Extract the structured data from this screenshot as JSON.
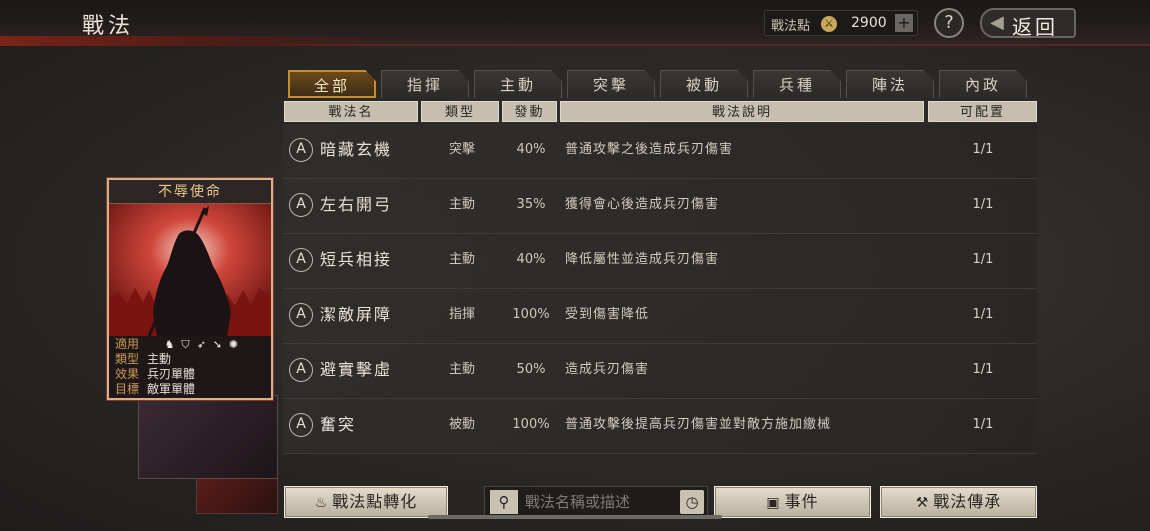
{
  "header": {
    "title": "戰法",
    "points_label": "戰法點",
    "points_value": "2900",
    "help_label": "?",
    "back_label": "返回"
  },
  "tabs": [
    {
      "label": "全部",
      "active": true
    },
    {
      "label": "指揮",
      "active": false
    },
    {
      "label": "主動",
      "active": false
    },
    {
      "label": "突擊",
      "active": false
    },
    {
      "label": "被動",
      "active": false
    },
    {
      "label": "兵種",
      "active": false
    },
    {
      "label": "陣法",
      "active": false
    },
    {
      "label": "內政",
      "active": false
    }
  ],
  "table": {
    "headers": {
      "name": "戰法名",
      "type": "類型",
      "rate": "發動",
      "desc": "戰法說明",
      "config": "可配置"
    },
    "rows": [
      {
        "grade": "A",
        "name": "暗藏玄機",
        "type": "突擊",
        "rate": "40%",
        "desc": "普通攻擊之後造成兵刃傷害",
        "config": "1/1"
      },
      {
        "grade": "A",
        "name": "左右開弓",
        "type": "主動",
        "rate": "35%",
        "desc": "獲得會心後造成兵刃傷害",
        "config": "1/1"
      },
      {
        "grade": "A",
        "name": "短兵相接",
        "type": "主動",
        "rate": "40%",
        "desc": "降低屬性並造成兵刃傷害",
        "config": "1/1"
      },
      {
        "grade": "A",
        "name": "潔敵屏障",
        "type": "指揮",
        "rate": "100%",
        "desc": "受到傷害降低",
        "config": "1/1"
      },
      {
        "grade": "A",
        "name": "避實擊虛",
        "type": "主動",
        "rate": "50%",
        "desc": "造成兵刃傷害",
        "config": "1/1"
      },
      {
        "grade": "A",
        "name": "奮突",
        "type": "被動",
        "rate": "100%",
        "desc": "普通攻擊後提高兵刃傷害並對敵方施加繳械",
        "config": "1/1"
      }
    ]
  },
  "card": {
    "title": "不辱使命",
    "applies_label": "適用",
    "unit_icons": [
      "cavalry-icon",
      "shield-icon",
      "bow-icon",
      "spear-icon",
      "siege-icon"
    ],
    "type_label": "類型",
    "type_value": "主動",
    "effect_label": "效果",
    "effect_value": "兵刃單體",
    "target_label": "目標",
    "target_value": "敵軍單體"
  },
  "bottom": {
    "convert_label": "戰法點轉化",
    "search_placeholder": "戰法名稱或描述",
    "events_label": "事件",
    "inherit_label": "戰法傳承"
  },
  "colors": {
    "accent_gold": "#c68d2e",
    "card_red": "#b02a22",
    "header_red": "#7a2418"
  }
}
